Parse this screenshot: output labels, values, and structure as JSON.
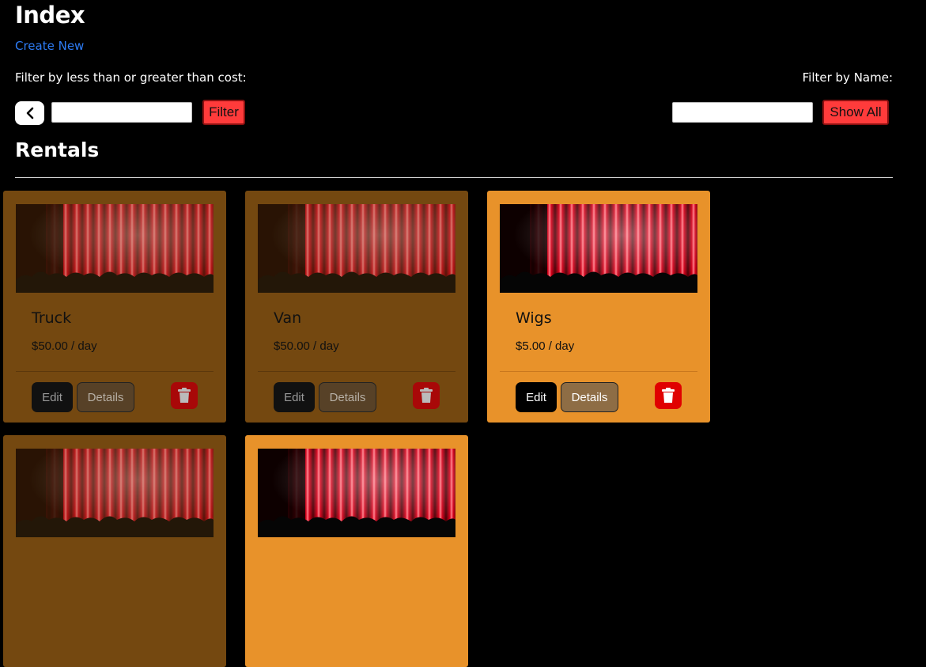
{
  "header": {
    "title": "Index",
    "create_link": "Create New"
  },
  "filters": {
    "cost_label": "Filter by less than or greater than cost:",
    "name_label": "Filter by Name:",
    "filter_button": "Filter",
    "show_all_button": "Show All",
    "cost_input_value": "",
    "name_input_value": ""
  },
  "section": {
    "title": "Rentals"
  },
  "cards": [
    {
      "name": "Truck",
      "price": "$50.00 / day",
      "edit": "Edit",
      "details": "Details",
      "delete_icon": "trash-icon"
    },
    {
      "name": "Van",
      "price": "$50.00 / day",
      "edit": "Edit",
      "details": "Details",
      "delete_icon": "trash-icon"
    },
    {
      "name": "Wigs",
      "price": "$5.00 / day",
      "edit": "Edit",
      "details": "Details",
      "delete_icon": "trash-icon"
    },
    {
      "name": "",
      "price": "",
      "edit": "",
      "details": "",
      "delete_icon": "trash-icon"
    },
    {
      "name": "",
      "price": "",
      "edit": "",
      "details": "",
      "delete_icon": "trash-icon"
    }
  ],
  "colors": {
    "card_active": "#e8922a",
    "card_dim": "#744810",
    "accent_red": "#ff3b3b",
    "link": "#2d7cf6"
  },
  "icons": {
    "toggle": "chevron-left-icon",
    "delete": "trash-icon",
    "image": "theater-curtain-image"
  }
}
